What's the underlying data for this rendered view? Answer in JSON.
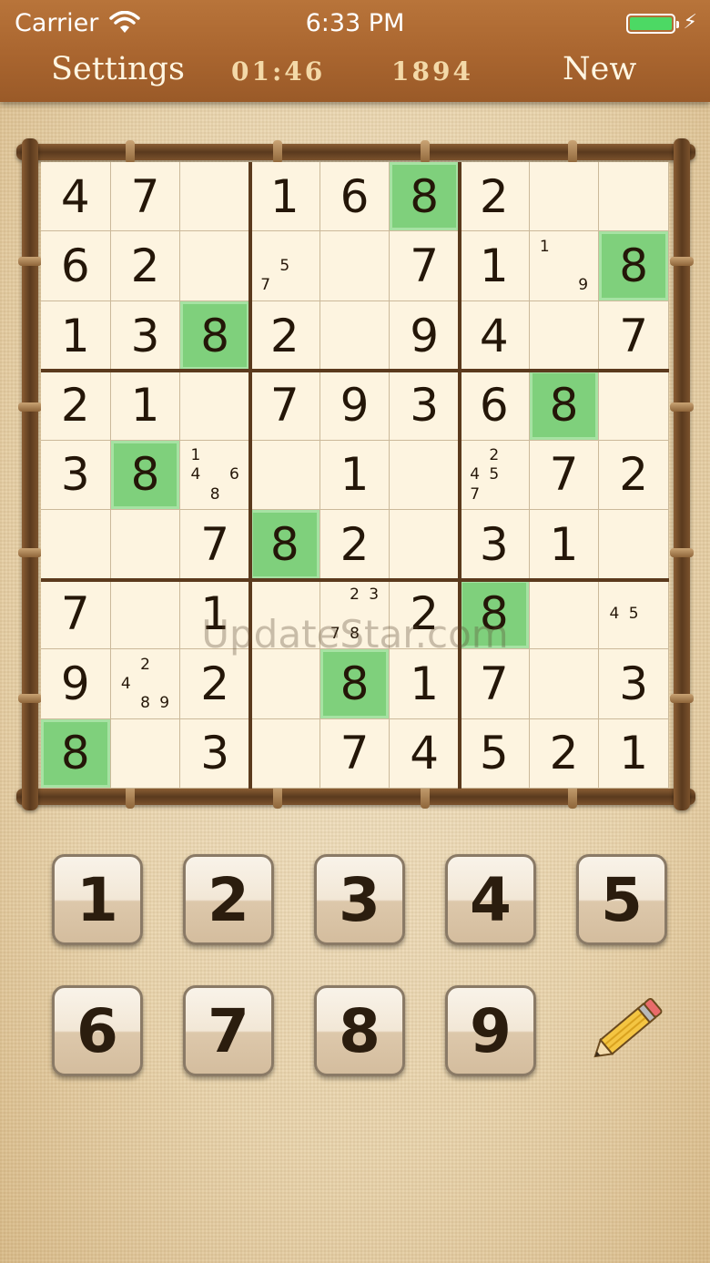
{
  "status_bar": {
    "carrier": "Carrier",
    "time": "6:33 PM",
    "battery_color": "#4cd964"
  },
  "nav": {
    "settings": "Settings",
    "timer": "01:46",
    "score": "1894",
    "new": "New"
  },
  "watermark": "UpdateStar.com",
  "grid": [
    [
      {
        "v": "4"
      },
      {
        "v": "7"
      },
      {
        "v": ""
      },
      {
        "v": "1"
      },
      {
        "v": "6"
      },
      {
        "v": "8",
        "hl": true
      },
      {
        "v": "2"
      },
      {
        "v": ""
      },
      {
        "v": ""
      }
    ],
    [
      {
        "v": "6"
      },
      {
        "v": "2"
      },
      {
        "v": ""
      },
      {
        "v": "",
        "notes": [
          "5",
          "7"
        ]
      },
      {
        "v": ""
      },
      {
        "v": "7"
      },
      {
        "v": "1"
      },
      {
        "v": "",
        "notes": [
          "1",
          "9"
        ]
      },
      {
        "v": "8",
        "hl": true
      }
    ],
    [
      {
        "v": "1"
      },
      {
        "v": "3"
      },
      {
        "v": "8",
        "hl": true
      },
      {
        "v": "2"
      },
      {
        "v": ""
      },
      {
        "v": "9"
      },
      {
        "v": "4"
      },
      {
        "v": ""
      },
      {
        "v": "7"
      }
    ],
    [
      {
        "v": "2"
      },
      {
        "v": "1"
      },
      {
        "v": ""
      },
      {
        "v": "7"
      },
      {
        "v": "9"
      },
      {
        "v": "3"
      },
      {
        "v": "6"
      },
      {
        "v": "8",
        "hl": true
      },
      {
        "v": ""
      }
    ],
    [
      {
        "v": "3"
      },
      {
        "v": "8",
        "hl": true
      },
      {
        "v": "",
        "notes": [
          "1",
          "4",
          "6",
          "8"
        ]
      },
      {
        "v": ""
      },
      {
        "v": "1"
      },
      {
        "v": ""
      },
      {
        "v": "",
        "notes": [
          "2",
          "4",
          "5",
          "7"
        ]
      },
      {
        "v": "7"
      },
      {
        "v": "2"
      }
    ],
    [
      {
        "v": ""
      },
      {
        "v": ""
      },
      {
        "v": "7"
      },
      {
        "v": "8",
        "hl": true
      },
      {
        "v": "2"
      },
      {
        "v": ""
      },
      {
        "v": "3"
      },
      {
        "v": "1"
      },
      {
        "v": ""
      }
    ],
    [
      {
        "v": "7"
      },
      {
        "v": ""
      },
      {
        "v": "1"
      },
      {
        "v": ""
      },
      {
        "v": "",
        "notes": [
          "2",
          "3",
          "7",
          "8"
        ]
      },
      {
        "v": "2"
      },
      {
        "v": "8",
        "hl": true
      },
      {
        "v": ""
      },
      {
        "v": "",
        "notes": [
          "4",
          "5"
        ]
      }
    ],
    [
      {
        "v": "9"
      },
      {
        "v": "",
        "notes": [
          "2",
          "4",
          "8",
          "9"
        ]
      },
      {
        "v": "2"
      },
      {
        "v": ""
      },
      {
        "v": "8",
        "hl": true
      },
      {
        "v": "1"
      },
      {
        "v": "7"
      },
      {
        "v": ""
      },
      {
        "v": "3"
      }
    ],
    [
      {
        "v": "8",
        "hl": true
      },
      {
        "v": ""
      },
      {
        "v": "3"
      },
      {
        "v": ""
      },
      {
        "v": "7"
      },
      {
        "v": "4"
      },
      {
        "v": "5"
      },
      {
        "v": "2"
      },
      {
        "v": "1"
      }
    ]
  ],
  "keypad": [
    "1",
    "2",
    "3",
    "4",
    "5",
    "6",
    "7",
    "8",
    "9"
  ],
  "highlight_color": "#7fd07c"
}
